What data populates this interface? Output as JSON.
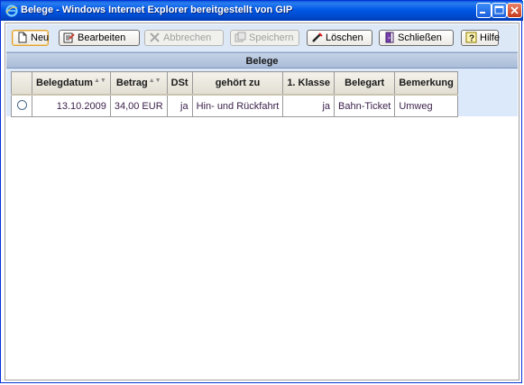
{
  "window": {
    "title": "Belege - Windows Internet Explorer bereitgestellt von GIP"
  },
  "toolbar": {
    "buttons": [
      {
        "label": "Neu",
        "icon": "new-document-icon",
        "state": "active"
      },
      {
        "label": "Bearbeiten",
        "icon": "edit-icon",
        "state": "enabled"
      },
      {
        "label": "Abbrechen",
        "icon": "cancel-icon",
        "state": "disabled"
      },
      {
        "label": "Speichern",
        "icon": "save-icon",
        "state": "disabled"
      },
      {
        "label": "Löschen",
        "icon": "delete-icon",
        "state": "enabled"
      },
      {
        "label": "Schließen",
        "icon": "close-icon",
        "state": "enabled"
      },
      {
        "label": "Hilfe",
        "icon": "help-icon",
        "state": "enabled"
      }
    ]
  },
  "section": {
    "title": "Belege"
  },
  "table": {
    "columns": [
      "Belegdatum",
      "Betrag",
      "DSt",
      "gehört zu",
      "1. Klasse",
      "Belegart",
      "Bemerkung"
    ],
    "sort_indicator": "▲▼",
    "rows": [
      {
        "selected": false,
        "cells": [
          "13.10.2009",
          "34,00 EUR",
          "ja",
          "Hin- und Rückfahrt",
          "ja",
          "Bahn-Ticket",
          "Umweg"
        ]
      }
    ]
  },
  "colors": {
    "titlebar": "#0058e6",
    "toolbar_bg": "#dde8f7",
    "section_bar": "#b5c6df",
    "grid_bg": "#dce9fb",
    "cell_text": "#3a1f4a"
  }
}
